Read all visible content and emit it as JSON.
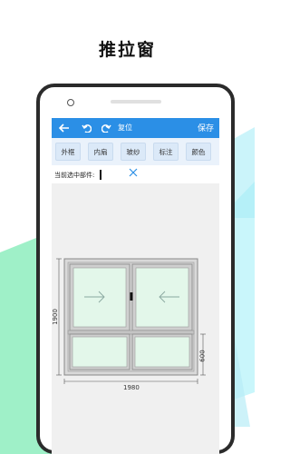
{
  "page_title": "推拉窗",
  "app": {
    "topbar": {
      "reset_label": "复位",
      "save_label": "保存"
    },
    "tools": [
      "外框",
      "内扇",
      "玻纱",
      "标注",
      "颜色"
    ],
    "selection_label": "当前选中部件:",
    "dimensions": {
      "width": "1980",
      "height": "1900",
      "lower_height": "600"
    }
  },
  "colors": {
    "accent": "#2b8fe6",
    "toolbar_bg": "#eaf2fb",
    "glass": "#e2f7ea",
    "frame": "#8a8a8a"
  }
}
